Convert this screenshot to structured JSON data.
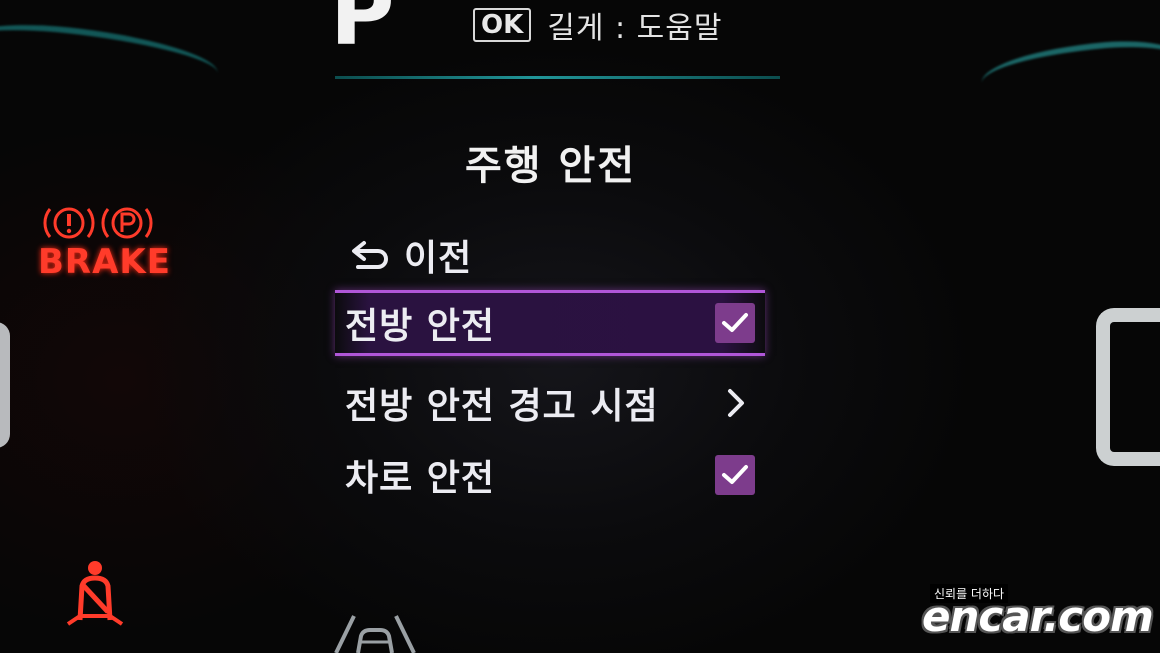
{
  "header": {
    "gear": "P",
    "ok_key": "OK",
    "help_text": "길게 : 도움말"
  },
  "menu": {
    "title": "주행 안전",
    "back_label": "이전",
    "items": [
      {
        "label": "전방 안전",
        "control": "checkbox",
        "checked": true,
        "selected": true
      },
      {
        "label": "전방 안전 경고 시점",
        "control": "chevron",
        "checked": null,
        "selected": false
      },
      {
        "label": "차로 안전",
        "control": "checkbox",
        "checked": true,
        "selected": false
      }
    ]
  },
  "warnings": {
    "brake_text": "BRAKE",
    "brake_icons": [
      "brake-warning-icon",
      "parking-brake-icon"
    ],
    "seatbelt_icon": "seatbelt-warning-icon"
  },
  "watermark": {
    "tagline": "신뢰를 더하다",
    "brand": "encar.com"
  },
  "colors": {
    "selection_accent": "#b056d8",
    "checkbox": "#7d3c8c",
    "warning_red": "#ff3b2a",
    "gauge_teal": "#27b9bd"
  }
}
